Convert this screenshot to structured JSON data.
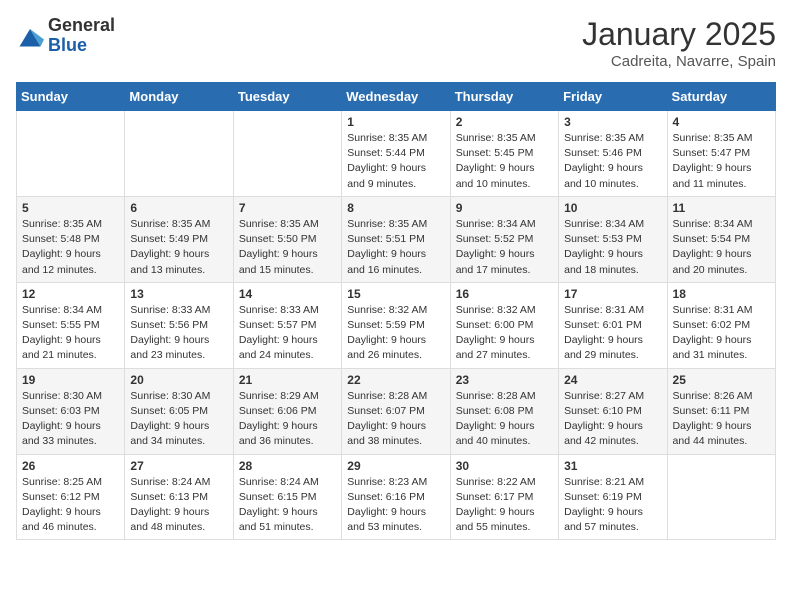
{
  "logo": {
    "general": "General",
    "blue": "Blue"
  },
  "header": {
    "month": "January 2025",
    "location": "Cadreita, Navarre, Spain"
  },
  "weekdays": [
    "Sunday",
    "Monday",
    "Tuesday",
    "Wednesday",
    "Thursday",
    "Friday",
    "Saturday"
  ],
  "weeks": [
    [
      {
        "day": "",
        "info": ""
      },
      {
        "day": "",
        "info": ""
      },
      {
        "day": "",
        "info": ""
      },
      {
        "day": "1",
        "info": "Sunrise: 8:35 AM\nSunset: 5:44 PM\nDaylight: 9 hours\nand 9 minutes."
      },
      {
        "day": "2",
        "info": "Sunrise: 8:35 AM\nSunset: 5:45 PM\nDaylight: 9 hours\nand 10 minutes."
      },
      {
        "day": "3",
        "info": "Sunrise: 8:35 AM\nSunset: 5:46 PM\nDaylight: 9 hours\nand 10 minutes."
      },
      {
        "day": "4",
        "info": "Sunrise: 8:35 AM\nSunset: 5:47 PM\nDaylight: 9 hours\nand 11 minutes."
      }
    ],
    [
      {
        "day": "5",
        "info": "Sunrise: 8:35 AM\nSunset: 5:48 PM\nDaylight: 9 hours\nand 12 minutes."
      },
      {
        "day": "6",
        "info": "Sunrise: 8:35 AM\nSunset: 5:49 PM\nDaylight: 9 hours\nand 13 minutes."
      },
      {
        "day": "7",
        "info": "Sunrise: 8:35 AM\nSunset: 5:50 PM\nDaylight: 9 hours\nand 15 minutes."
      },
      {
        "day": "8",
        "info": "Sunrise: 8:35 AM\nSunset: 5:51 PM\nDaylight: 9 hours\nand 16 minutes."
      },
      {
        "day": "9",
        "info": "Sunrise: 8:34 AM\nSunset: 5:52 PM\nDaylight: 9 hours\nand 17 minutes."
      },
      {
        "day": "10",
        "info": "Sunrise: 8:34 AM\nSunset: 5:53 PM\nDaylight: 9 hours\nand 18 minutes."
      },
      {
        "day": "11",
        "info": "Sunrise: 8:34 AM\nSunset: 5:54 PM\nDaylight: 9 hours\nand 20 minutes."
      }
    ],
    [
      {
        "day": "12",
        "info": "Sunrise: 8:34 AM\nSunset: 5:55 PM\nDaylight: 9 hours\nand 21 minutes."
      },
      {
        "day": "13",
        "info": "Sunrise: 8:33 AM\nSunset: 5:56 PM\nDaylight: 9 hours\nand 23 minutes."
      },
      {
        "day": "14",
        "info": "Sunrise: 8:33 AM\nSunset: 5:57 PM\nDaylight: 9 hours\nand 24 minutes."
      },
      {
        "day": "15",
        "info": "Sunrise: 8:32 AM\nSunset: 5:59 PM\nDaylight: 9 hours\nand 26 minutes."
      },
      {
        "day": "16",
        "info": "Sunrise: 8:32 AM\nSunset: 6:00 PM\nDaylight: 9 hours\nand 27 minutes."
      },
      {
        "day": "17",
        "info": "Sunrise: 8:31 AM\nSunset: 6:01 PM\nDaylight: 9 hours\nand 29 minutes."
      },
      {
        "day": "18",
        "info": "Sunrise: 8:31 AM\nSunset: 6:02 PM\nDaylight: 9 hours\nand 31 minutes."
      }
    ],
    [
      {
        "day": "19",
        "info": "Sunrise: 8:30 AM\nSunset: 6:03 PM\nDaylight: 9 hours\nand 33 minutes."
      },
      {
        "day": "20",
        "info": "Sunrise: 8:30 AM\nSunset: 6:05 PM\nDaylight: 9 hours\nand 34 minutes."
      },
      {
        "day": "21",
        "info": "Sunrise: 8:29 AM\nSunset: 6:06 PM\nDaylight: 9 hours\nand 36 minutes."
      },
      {
        "day": "22",
        "info": "Sunrise: 8:28 AM\nSunset: 6:07 PM\nDaylight: 9 hours\nand 38 minutes."
      },
      {
        "day": "23",
        "info": "Sunrise: 8:28 AM\nSunset: 6:08 PM\nDaylight: 9 hours\nand 40 minutes."
      },
      {
        "day": "24",
        "info": "Sunrise: 8:27 AM\nSunset: 6:10 PM\nDaylight: 9 hours\nand 42 minutes."
      },
      {
        "day": "25",
        "info": "Sunrise: 8:26 AM\nSunset: 6:11 PM\nDaylight: 9 hours\nand 44 minutes."
      }
    ],
    [
      {
        "day": "26",
        "info": "Sunrise: 8:25 AM\nSunset: 6:12 PM\nDaylight: 9 hours\nand 46 minutes."
      },
      {
        "day": "27",
        "info": "Sunrise: 8:24 AM\nSunset: 6:13 PM\nDaylight: 9 hours\nand 48 minutes."
      },
      {
        "day": "28",
        "info": "Sunrise: 8:24 AM\nSunset: 6:15 PM\nDaylight: 9 hours\nand 51 minutes."
      },
      {
        "day": "29",
        "info": "Sunrise: 8:23 AM\nSunset: 6:16 PM\nDaylight: 9 hours\nand 53 minutes."
      },
      {
        "day": "30",
        "info": "Sunrise: 8:22 AM\nSunset: 6:17 PM\nDaylight: 9 hours\nand 55 minutes."
      },
      {
        "day": "31",
        "info": "Sunrise: 8:21 AM\nSunset: 6:19 PM\nDaylight: 9 hours\nand 57 minutes."
      },
      {
        "day": "",
        "info": ""
      }
    ]
  ]
}
